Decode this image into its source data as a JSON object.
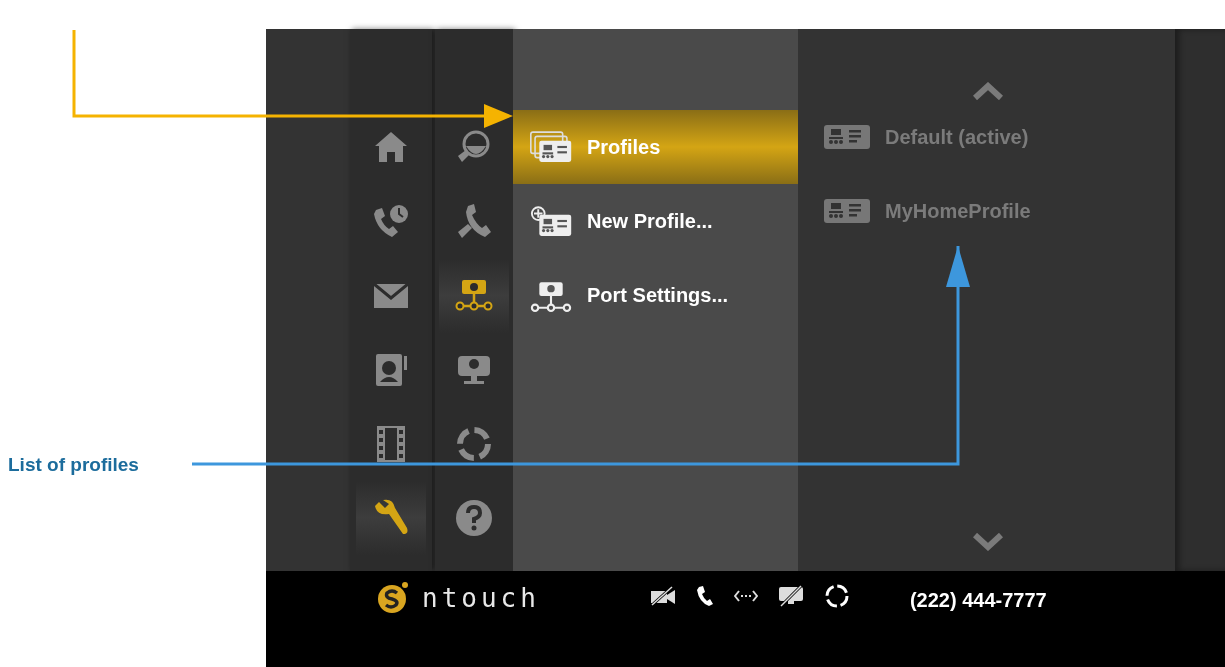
{
  "callout": {
    "label": "List of profiles"
  },
  "nav_primary": [
    {
      "selected": false
    },
    {
      "selected": false
    },
    {
      "selected": false
    },
    {
      "selected": false
    },
    {
      "selected": false
    },
    {
      "selected": true
    }
  ],
  "nav_secondary": [
    {
      "selected": false
    },
    {
      "selected": false
    },
    {
      "selected": true
    },
    {
      "selected": false
    },
    {
      "selected": false
    },
    {
      "selected": false
    }
  ],
  "menu": [
    {
      "label": "Profiles",
      "selected": true
    },
    {
      "label": "New Profile...",
      "selected": false
    },
    {
      "label": "Port Settings...",
      "selected": false
    }
  ],
  "profiles": [
    {
      "label": "Default (active)"
    },
    {
      "label": "MyHomeProfile"
    }
  ],
  "status_bar": {
    "logo_text": "ntouch",
    "phone": "(222) 444-7777"
  }
}
